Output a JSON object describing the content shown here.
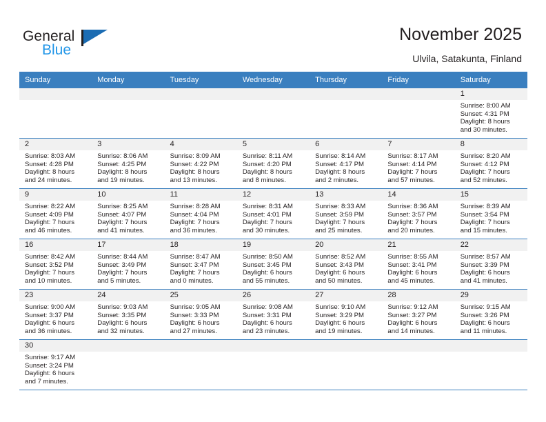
{
  "brand": {
    "name_primary": "General",
    "name_secondary": "Blue",
    "flag_color": "#1b6cb3",
    "secondary_color": "#2196e8"
  },
  "header": {
    "title": "November 2025",
    "location": "Ulvila, Satakunta, Finland"
  },
  "theme": {
    "header_band_color": "#3a7fbf",
    "daynum_band_color": "#f1f1f1",
    "text_color": "#231f20"
  },
  "weekdays": [
    "Sunday",
    "Monday",
    "Tuesday",
    "Wednesday",
    "Thursday",
    "Friday",
    "Saturday"
  ],
  "labels": {
    "sunrise_prefix": "Sunrise:",
    "sunset_prefix": "Sunset:",
    "daylight_prefix": "Daylight:"
  },
  "weeks": [
    [
      {
        "blank": true
      },
      {
        "blank": true
      },
      {
        "blank": true
      },
      {
        "blank": true
      },
      {
        "blank": true
      },
      {
        "blank": true
      },
      {
        "day": "1",
        "sunrise": "Sunrise: 8:00 AM",
        "sunset": "Sunset: 4:31 PM",
        "daylight_line1": "Daylight: 8 hours",
        "daylight_line2": "and 30 minutes."
      }
    ],
    [
      {
        "day": "2",
        "sunrise": "Sunrise: 8:03 AM",
        "sunset": "Sunset: 4:28 PM",
        "daylight_line1": "Daylight: 8 hours",
        "daylight_line2": "and 24 minutes."
      },
      {
        "day": "3",
        "sunrise": "Sunrise: 8:06 AM",
        "sunset": "Sunset: 4:25 PM",
        "daylight_line1": "Daylight: 8 hours",
        "daylight_line2": "and 19 minutes."
      },
      {
        "day": "4",
        "sunrise": "Sunrise: 8:09 AM",
        "sunset": "Sunset: 4:22 PM",
        "daylight_line1": "Daylight: 8 hours",
        "daylight_line2": "and 13 minutes."
      },
      {
        "day": "5",
        "sunrise": "Sunrise: 8:11 AM",
        "sunset": "Sunset: 4:20 PM",
        "daylight_line1": "Daylight: 8 hours",
        "daylight_line2": "and 8 minutes."
      },
      {
        "day": "6",
        "sunrise": "Sunrise: 8:14 AM",
        "sunset": "Sunset: 4:17 PM",
        "daylight_line1": "Daylight: 8 hours",
        "daylight_line2": "and 2 minutes."
      },
      {
        "day": "7",
        "sunrise": "Sunrise: 8:17 AM",
        "sunset": "Sunset: 4:14 PM",
        "daylight_line1": "Daylight: 7 hours",
        "daylight_line2": "and 57 minutes."
      },
      {
        "day": "8",
        "sunrise": "Sunrise: 8:20 AM",
        "sunset": "Sunset: 4:12 PM",
        "daylight_line1": "Daylight: 7 hours",
        "daylight_line2": "and 52 minutes."
      }
    ],
    [
      {
        "day": "9",
        "sunrise": "Sunrise: 8:22 AM",
        "sunset": "Sunset: 4:09 PM",
        "daylight_line1": "Daylight: 7 hours",
        "daylight_line2": "and 46 minutes."
      },
      {
        "day": "10",
        "sunrise": "Sunrise: 8:25 AM",
        "sunset": "Sunset: 4:07 PM",
        "daylight_line1": "Daylight: 7 hours",
        "daylight_line2": "and 41 minutes."
      },
      {
        "day": "11",
        "sunrise": "Sunrise: 8:28 AM",
        "sunset": "Sunset: 4:04 PM",
        "daylight_line1": "Daylight: 7 hours",
        "daylight_line2": "and 36 minutes."
      },
      {
        "day": "12",
        "sunrise": "Sunrise: 8:31 AM",
        "sunset": "Sunset: 4:01 PM",
        "daylight_line1": "Daylight: 7 hours",
        "daylight_line2": "and 30 minutes."
      },
      {
        "day": "13",
        "sunrise": "Sunrise: 8:33 AM",
        "sunset": "Sunset: 3:59 PM",
        "daylight_line1": "Daylight: 7 hours",
        "daylight_line2": "and 25 minutes."
      },
      {
        "day": "14",
        "sunrise": "Sunrise: 8:36 AM",
        "sunset": "Sunset: 3:57 PM",
        "daylight_line1": "Daylight: 7 hours",
        "daylight_line2": "and 20 minutes."
      },
      {
        "day": "15",
        "sunrise": "Sunrise: 8:39 AM",
        "sunset": "Sunset: 3:54 PM",
        "daylight_line1": "Daylight: 7 hours",
        "daylight_line2": "and 15 minutes."
      }
    ],
    [
      {
        "day": "16",
        "sunrise": "Sunrise: 8:42 AM",
        "sunset": "Sunset: 3:52 PM",
        "daylight_line1": "Daylight: 7 hours",
        "daylight_line2": "and 10 minutes."
      },
      {
        "day": "17",
        "sunrise": "Sunrise: 8:44 AM",
        "sunset": "Sunset: 3:49 PM",
        "daylight_line1": "Daylight: 7 hours",
        "daylight_line2": "and 5 minutes."
      },
      {
        "day": "18",
        "sunrise": "Sunrise: 8:47 AM",
        "sunset": "Sunset: 3:47 PM",
        "daylight_line1": "Daylight: 7 hours",
        "daylight_line2": "and 0 minutes."
      },
      {
        "day": "19",
        "sunrise": "Sunrise: 8:50 AM",
        "sunset": "Sunset: 3:45 PM",
        "daylight_line1": "Daylight: 6 hours",
        "daylight_line2": "and 55 minutes."
      },
      {
        "day": "20",
        "sunrise": "Sunrise: 8:52 AM",
        "sunset": "Sunset: 3:43 PM",
        "daylight_line1": "Daylight: 6 hours",
        "daylight_line2": "and 50 minutes."
      },
      {
        "day": "21",
        "sunrise": "Sunrise: 8:55 AM",
        "sunset": "Sunset: 3:41 PM",
        "daylight_line1": "Daylight: 6 hours",
        "daylight_line2": "and 45 minutes."
      },
      {
        "day": "22",
        "sunrise": "Sunrise: 8:57 AM",
        "sunset": "Sunset: 3:39 PM",
        "daylight_line1": "Daylight: 6 hours",
        "daylight_line2": "and 41 minutes."
      }
    ],
    [
      {
        "day": "23",
        "sunrise": "Sunrise: 9:00 AM",
        "sunset": "Sunset: 3:37 PM",
        "daylight_line1": "Daylight: 6 hours",
        "daylight_line2": "and 36 minutes."
      },
      {
        "day": "24",
        "sunrise": "Sunrise: 9:03 AM",
        "sunset": "Sunset: 3:35 PM",
        "daylight_line1": "Daylight: 6 hours",
        "daylight_line2": "and 32 minutes."
      },
      {
        "day": "25",
        "sunrise": "Sunrise: 9:05 AM",
        "sunset": "Sunset: 3:33 PM",
        "daylight_line1": "Daylight: 6 hours",
        "daylight_line2": "and 27 minutes."
      },
      {
        "day": "26",
        "sunrise": "Sunrise: 9:08 AM",
        "sunset": "Sunset: 3:31 PM",
        "daylight_line1": "Daylight: 6 hours",
        "daylight_line2": "and 23 minutes."
      },
      {
        "day": "27",
        "sunrise": "Sunrise: 9:10 AM",
        "sunset": "Sunset: 3:29 PM",
        "daylight_line1": "Daylight: 6 hours",
        "daylight_line2": "and 19 minutes."
      },
      {
        "day": "28",
        "sunrise": "Sunrise: 9:12 AM",
        "sunset": "Sunset: 3:27 PM",
        "daylight_line1": "Daylight: 6 hours",
        "daylight_line2": "and 14 minutes."
      },
      {
        "day": "29",
        "sunrise": "Sunrise: 9:15 AM",
        "sunset": "Sunset: 3:26 PM",
        "daylight_line1": "Daylight: 6 hours",
        "daylight_line2": "and 11 minutes."
      }
    ],
    [
      {
        "day": "30",
        "sunrise": "Sunrise: 9:17 AM",
        "sunset": "Sunset: 3:24 PM",
        "daylight_line1": "Daylight: 6 hours",
        "daylight_line2": "and 7 minutes."
      },
      {
        "blank": true
      },
      {
        "blank": true
      },
      {
        "blank": true
      },
      {
        "blank": true
      },
      {
        "blank": true
      },
      {
        "blank": true
      }
    ]
  ]
}
